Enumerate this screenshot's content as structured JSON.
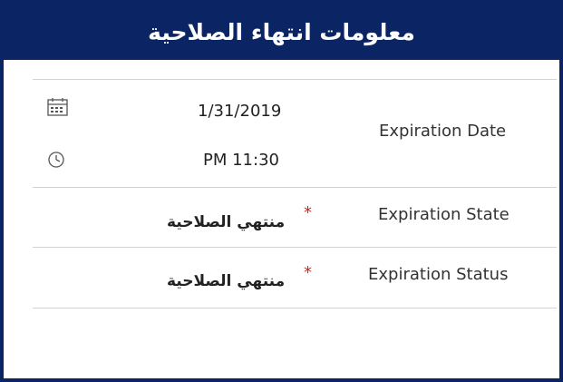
{
  "header": {
    "title": "معلومات انتهاء الصلاحية"
  },
  "fields": {
    "expiration_date": {
      "label": "Expiration Date",
      "date_value": "1/31/2019",
      "time_value": "PM 11:30"
    },
    "expiration_state": {
      "label": "Expiration State",
      "required_marker": "*",
      "value": "منتهي الصلاحية"
    },
    "expiration_status": {
      "label": "Expiration Status",
      "required_marker": "*",
      "value": "منتهي الصلاحية"
    }
  },
  "icons": {
    "date": "calendar-icon",
    "time": "clock-icon"
  },
  "colors": {
    "header_background": "#0b2463",
    "header_text": "#ffffff",
    "required_marker": "#c8281e",
    "divider": "#d2d2d2"
  }
}
